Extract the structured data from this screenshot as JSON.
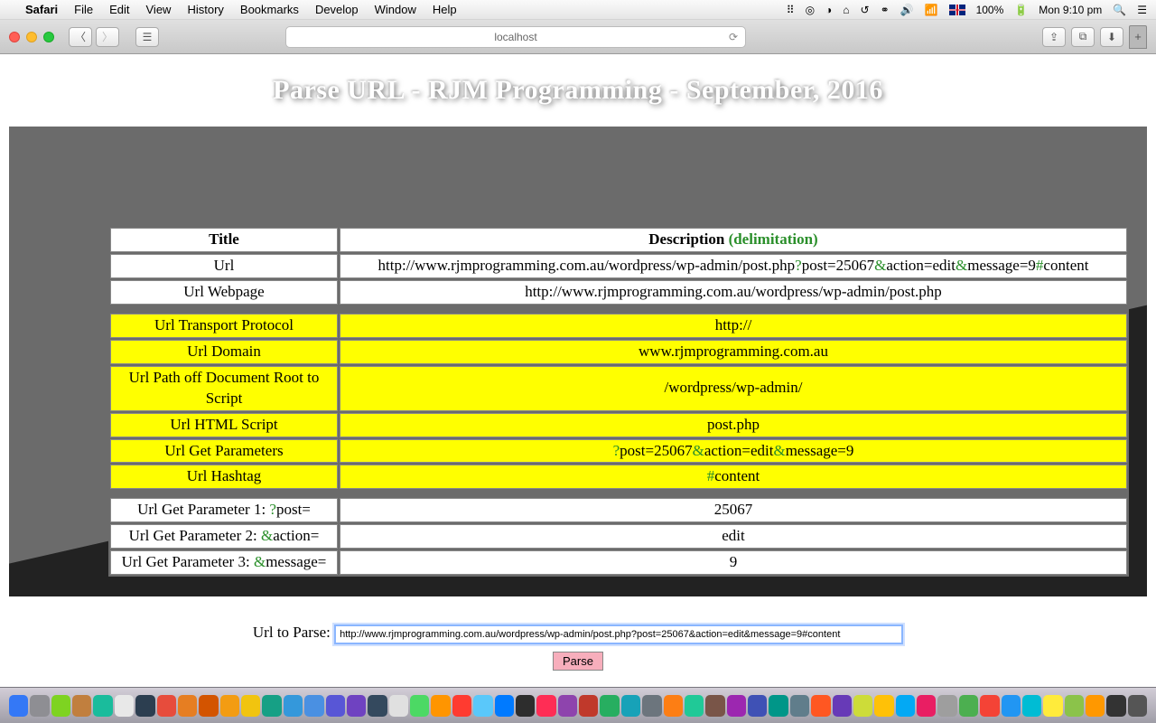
{
  "menubar": {
    "app": "Safari",
    "items": [
      "File",
      "Edit",
      "View",
      "History",
      "Bookmarks",
      "Develop",
      "Window",
      "Help"
    ],
    "battery": "100%",
    "clock": "Mon 9:10 pm"
  },
  "browser": {
    "address": "localhost"
  },
  "heading": "Parse URL - RJM Programming - September, 2016",
  "header": {
    "title": "Title",
    "desc": "Description",
    "delim": " (delimitation)"
  },
  "rows": {
    "r0t": "Url",
    "r0d_pre": "http",
    "r0d_a": "://www.rjmprogramming.com.au/wordpress/wp-admin/post.php",
    "r0d_b": "post=25067",
    "r0d_c": "action=edit",
    "r0d_d": "message=9",
    "r0d_e": "content",
    "q": "?",
    "amp": "&",
    "hash": "#",
    "r1t": "Url Webpage",
    "r1d": "http://www.rjmprogramming.com.au/wordpress/wp-admin/post.php",
    "r2t": "Url Transport Protocol",
    "r2d": "http://",
    "r3t": "Url Domain",
    "r3d": "www.rjmprogramming.com.au",
    "r4t": "Url Path off Document Root to Script",
    "r4d": "/wordpress/wp-admin/",
    "r5t": "Url HTML Script",
    "r5d": "post.php",
    "r6t": "Url Get Parameters",
    "r6d_a": "post=25067",
    "r6d_b": "action=edit",
    "r6d_c": "message=9",
    "r7t": "Url Hashtag",
    "r7d_a": "content",
    "p1l": "Url Get Parameter 1: ",
    "p1k": "post=",
    "p1v": "25067",
    "p2l": "Url Get Parameter 2: ",
    "p2k": "action=",
    "p2v": "edit",
    "p3l": "Url Get Parameter 3: ",
    "p3k": "message=",
    "p3v": "9"
  },
  "form": {
    "label": "Url to Parse: ",
    "value": "http://www.rjmprogramming.com.au/wordpress/wp-admin/post.php?post=25067&action=edit&message=9#content",
    "button": "Parse"
  },
  "dock_colors": [
    "#3478f6",
    "#8e8e93",
    "#7ed321",
    "#c17f3e",
    "#1abc9c",
    "#e8e8e8",
    "#2c3e50",
    "#e74c3c",
    "#e67e22",
    "#d35400",
    "#f39c12",
    "#f1c40f",
    "#16a085",
    "#3498db",
    "#4a90e2",
    "#5856d6",
    "#6f42c1",
    "#34495e",
    "#e0e0e0",
    "#4cd964",
    "#ff9500",
    "#ff3b30",
    "#5ac8fa",
    "#007aff",
    "#2d2d2d",
    "#ff2d55",
    "#8e44ad",
    "#c0392b",
    "#27ae60",
    "#17a2b8",
    "#6c757d",
    "#fd7e14",
    "#20c997",
    "#795548",
    "#9c27b0",
    "#3f51b5",
    "#009688",
    "#607d8b",
    "#ff5722",
    "#673ab7",
    "#cddc39",
    "#ffc107",
    "#03a9f4",
    "#e91e63",
    "#9e9e9e",
    "#4caf50",
    "#f44336",
    "#2196f3",
    "#00bcd4",
    "#ffeb3b",
    "#8bc34a",
    "#ff9800",
    "#333",
    "#555"
  ]
}
